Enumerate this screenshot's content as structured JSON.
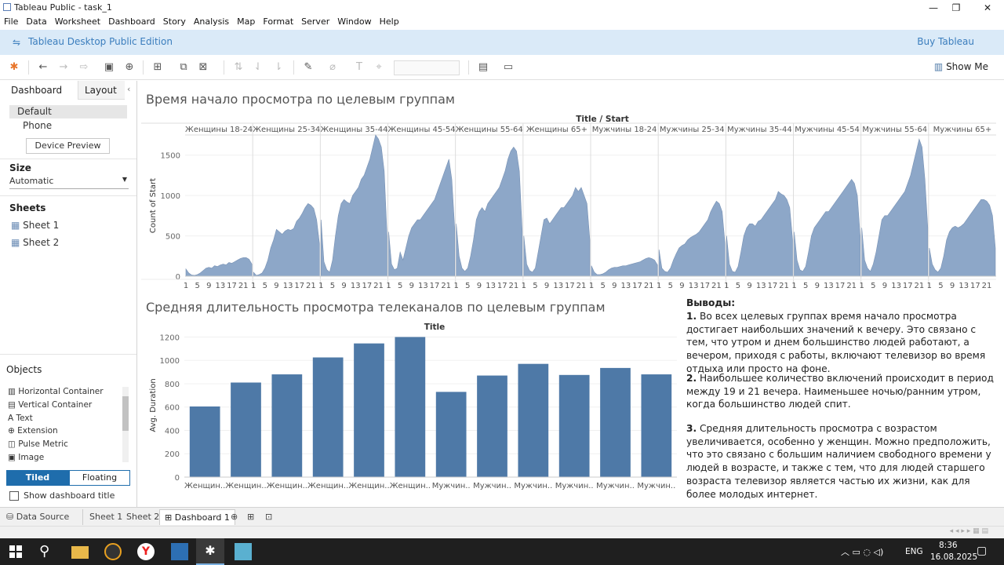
{
  "window": {
    "title": "Tableau Public - task_1",
    "min": "—",
    "max": "❐",
    "close": "✕"
  },
  "menu": [
    "File",
    "Data",
    "Worksheet",
    "Dashboard",
    "Story",
    "Analysis",
    "Map",
    "Format",
    "Server",
    "Window",
    "Help"
  ],
  "edition": {
    "label": "Tableau Desktop Public Edition",
    "buy": "Buy Tableau"
  },
  "toolbar": {
    "show_me": "Show Me"
  },
  "leftpane": {
    "tabs": [
      "Dashboard",
      "Layout"
    ],
    "device_options": [
      "Default",
      "Phone"
    ],
    "device_preview": "Device Preview",
    "size_label": "Size",
    "size_value": "Automatic",
    "sheets_label": "Sheets",
    "sheets": [
      "Sheet 1",
      "Sheet 2"
    ],
    "objects_label": "Objects",
    "objects": [
      "Horizontal Container",
      "Vertical Container",
      "Text",
      "Extension",
      "Pulse Metric",
      "Image"
    ],
    "tiled": "Tiled",
    "floating": "Floating",
    "show_title": "Show dashboard title"
  },
  "dashboard": {
    "title1": "Время начало просмотра по целевым группам",
    "title2": "Средняя длительность просмотра телеканалов по целевым группам",
    "conclusions_title": "Выводы:",
    "conclusions": [
      {
        "num": "1.",
        "text": " Во всех целевых группах время начало просмотра достигает наибольших значений к вечеру. Это связано с тем, что утром и днем большинство людей работают, а вечером, приходя с работы, включают телевизор во время отдыха или просто на фоне."
      },
      {
        "num": "2.",
        "text": " Наибольшее количество включений происходит в период между 19 и 21 вечера. Наименьшее ночью/ранним утром, когда большинство людей спит."
      },
      {
        "num": "3.",
        "text": " Средняя длительность просмотра с возрастом увеличивается, особенно у женщин. Можно предположить, что это связано с большим наличием свободного времени у людей в возрасте, и также с тем, что для людей старшего возраста телевизор является частью их жизни, как для более молодых интернет."
      }
    ]
  },
  "chart_data": [
    {
      "type": "area",
      "header": "Title / Start",
      "ylabel": "Count of Start",
      "ylim": [
        0,
        1750
      ],
      "yticks": [
        0,
        500,
        1000,
        1500
      ],
      "x_ticks": [
        "1",
        "5",
        "9",
        "13",
        "17",
        "21"
      ],
      "color": "#8da7c8",
      "panels": [
        {
          "name": "Женщины 18-24",
          "x": [
            1,
            2,
            3,
            4,
            5,
            6,
            7,
            8,
            9,
            10,
            11,
            12,
            13,
            14,
            15,
            16,
            17,
            18,
            19,
            20,
            21,
            22,
            23,
            24
          ],
          "values": [
            90,
            40,
            15,
            10,
            20,
            40,
            70,
            100,
            110,
            100,
            130,
            120,
            140,
            150,
            140,
            170,
            160,
            180,
            200,
            220,
            230,
            230,
            210,
            150
          ]
        },
        {
          "name": "Женщины 25-34",
          "x": [
            1,
            2,
            3,
            4,
            5,
            6,
            7,
            8,
            9,
            10,
            11,
            12,
            13,
            14,
            15,
            16,
            17,
            18,
            19,
            20,
            21,
            22,
            23,
            24
          ],
          "values": [
            50,
            10,
            20,
            40,
            100,
            200,
            350,
            450,
            580,
            550,
            520,
            560,
            580,
            570,
            590,
            680,
            720,
            780,
            850,
            900,
            880,
            840,
            700,
            400
          ]
        },
        {
          "name": "Женщины 35-44",
          "x": [
            1,
            2,
            3,
            4,
            5,
            6,
            7,
            8,
            9,
            10,
            11,
            12,
            13,
            14,
            15,
            16,
            17,
            18,
            19,
            20,
            21,
            22,
            23,
            24
          ],
          "values": [
            700,
            180,
            80,
            50,
            200,
            500,
            750,
            900,
            950,
            920,
            900,
            1000,
            1050,
            1100,
            1200,
            1250,
            1350,
            1450,
            1600,
            1750,
            1700,
            1600,
            1300,
            500
          ]
        },
        {
          "name": "Женщины 45-54",
          "x": [
            1,
            2,
            3,
            4,
            5,
            6,
            7,
            8,
            9,
            10,
            11,
            12,
            13,
            14,
            15,
            16,
            17,
            18,
            19,
            20,
            21,
            22,
            23,
            24
          ],
          "values": [
            550,
            150,
            80,
            100,
            300,
            200,
            350,
            500,
            600,
            650,
            700,
            700,
            750,
            800,
            850,
            900,
            950,
            1050,
            1150,
            1250,
            1350,
            1450,
            1200,
            600
          ]
        },
        {
          "name": "Женщины 55-64",
          "x": [
            1,
            2,
            3,
            4,
            5,
            6,
            7,
            8,
            9,
            10,
            11,
            12,
            13,
            14,
            15,
            16,
            17,
            18,
            19,
            20,
            21,
            22,
            23,
            24
          ],
          "values": [
            650,
            250,
            100,
            60,
            100,
            250,
            450,
            700,
            800,
            850,
            800,
            900,
            950,
            1000,
            1050,
            1100,
            1200,
            1300,
            1450,
            1550,
            1600,
            1550,
            1300,
            550
          ]
        },
        {
          "name": "Женщины 65+",
          "x": [
            1,
            2,
            3,
            4,
            5,
            6,
            7,
            8,
            9,
            10,
            11,
            12,
            13,
            14,
            15,
            16,
            17,
            18,
            19,
            20,
            21,
            22,
            23,
            24
          ],
          "values": [
            500,
            150,
            70,
            50,
            100,
            300,
            500,
            700,
            720,
            650,
            700,
            750,
            800,
            850,
            850,
            900,
            950,
            1000,
            1100,
            1050,
            1100,
            1000,
            900,
            450
          ]
        },
        {
          "name": "Мужчины 18-24",
          "x": [
            1,
            2,
            3,
            4,
            5,
            6,
            7,
            8,
            9,
            10,
            11,
            12,
            13,
            14,
            15,
            16,
            17,
            18,
            19,
            20,
            21,
            22,
            23,
            24
          ],
          "values": [
            130,
            50,
            20,
            20,
            30,
            50,
            80,
            100,
            110,
            110,
            120,
            130,
            130,
            140,
            150,
            160,
            170,
            180,
            200,
            220,
            230,
            220,
            200,
            140
          ]
        },
        {
          "name": "Мужчины 25-34",
          "x": [
            1,
            2,
            3,
            4,
            5,
            6,
            7,
            8,
            9,
            10,
            11,
            12,
            13,
            14,
            15,
            16,
            17,
            18,
            19,
            20,
            21,
            22,
            23,
            24
          ],
          "values": [
            330,
            100,
            60,
            50,
            100,
            200,
            280,
            350,
            380,
            400,
            450,
            480,
            500,
            520,
            550,
            600,
            650,
            700,
            800,
            870,
            930,
            900,
            800,
            400
          ]
        },
        {
          "name": "Мужчины 35-44",
          "x": [
            1,
            2,
            3,
            4,
            5,
            6,
            7,
            8,
            9,
            10,
            11,
            12,
            13,
            14,
            15,
            16,
            17,
            18,
            19,
            20,
            21,
            22,
            23,
            24
          ],
          "values": [
            500,
            150,
            60,
            50,
            120,
            300,
            500,
            600,
            650,
            650,
            620,
            680,
            700,
            750,
            800,
            850,
            900,
            950,
            1050,
            1020,
            1000,
            950,
            850,
            450
          ]
        },
        {
          "name": "Мужчины 45-54",
          "x": [
            1,
            2,
            3,
            4,
            5,
            6,
            7,
            8,
            9,
            10,
            11,
            12,
            13,
            14,
            15,
            16,
            17,
            18,
            19,
            20,
            21,
            22,
            23,
            24
          ],
          "values": [
            550,
            200,
            80,
            60,
            120,
            300,
            500,
            600,
            650,
            700,
            750,
            800,
            800,
            850,
            900,
            950,
            1000,
            1050,
            1100,
            1150,
            1200,
            1150,
            1000,
            500
          ]
        },
        {
          "name": "Мужчины 55-64",
          "x": [
            1,
            2,
            3,
            4,
            5,
            6,
            7,
            8,
            9,
            10,
            11,
            12,
            13,
            14,
            15,
            16,
            17,
            18,
            19,
            20,
            21,
            22,
            23,
            24
          ],
          "values": [
            600,
            200,
            100,
            60,
            150,
            300,
            500,
            700,
            750,
            750,
            800,
            850,
            900,
            950,
            1000,
            1050,
            1150,
            1250,
            1400,
            1550,
            1700,
            1600,
            1200,
            600
          ]
        },
        {
          "name": "Мужчины 65+",
          "x": [
            1,
            2,
            3,
            4,
            5,
            6,
            7,
            8,
            9,
            10,
            11,
            12,
            13,
            14,
            15,
            16,
            17,
            18,
            19,
            20,
            21,
            22,
            23,
            24
          ],
          "values": [
            350,
            150,
            80,
            50,
            100,
            250,
            450,
            550,
            600,
            620,
            600,
            620,
            650,
            700,
            750,
            800,
            850,
            900,
            950,
            950,
            930,
            880,
            750,
            350
          ]
        }
      ]
    },
    {
      "type": "bar",
      "header": "Title",
      "ylabel": "Avg. Duration",
      "ylim": [
        0,
        1230
      ],
      "yticks": [
        0,
        200,
        400,
        600,
        800,
        1000,
        1200
      ],
      "color": "#4e79a7",
      "categories": [
        "Женщин..",
        "Женщин..",
        "Женщин..",
        "Женщин..",
        "Женщин..",
        "Женщин..",
        "Мужчин..",
        "Мужчин..",
        "Мужчин..",
        "Мужчин..",
        "Мужчин..",
        "Мужчин.."
      ],
      "values": [
        605,
        810,
        880,
        1025,
        1145,
        1200,
        730,
        870,
        970,
        875,
        935,
        880
      ]
    }
  ],
  "sheettabs": {
    "data_source": "Data Source",
    "sheets": [
      "Sheet 1",
      "Sheet 2",
      "Dashboard 1"
    ]
  },
  "taskbar": {
    "lang": "ENG",
    "time": "8:36",
    "date": "16.08.2025"
  }
}
